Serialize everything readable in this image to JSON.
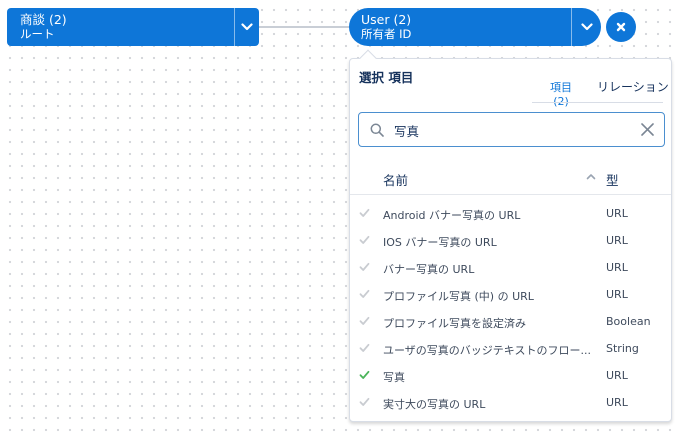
{
  "colors": {
    "accent": "#0e76d8",
    "check_active": "#4bb45a",
    "check_inactive": "#c9ccd1",
    "text": "#16325c"
  },
  "nodes": {
    "left": {
      "title": "商談 (2)",
      "subtitle": "ルート",
      "icon": "chevron-down-icon"
    },
    "right": {
      "title": "User (2)",
      "subtitle": "所有者 ID",
      "icon": "chevron-down-icon"
    },
    "close_icon": "close-icon"
  },
  "panel": {
    "title": "選択 項目",
    "tabs": [
      {
        "label": "項目 (2)",
        "active": true
      },
      {
        "label": "リレーション",
        "active": false
      }
    ],
    "search": {
      "value": "写真",
      "icon": "search-icon",
      "clear_icon": "clear-icon"
    },
    "columns": {
      "name": "名前",
      "type": "型",
      "sort_icon": "sort-up-icon"
    },
    "rows": [
      {
        "name": "Android バナー写真の URL",
        "type": "URL",
        "selected": false
      },
      {
        "name": "IOS バナー写真の URL",
        "type": "URL",
        "selected": false
      },
      {
        "name": "バナー写真の URL",
        "type": "URL",
        "selected": false
      },
      {
        "name": "プロファイル写真 (中) の URL",
        "type": "URL",
        "selected": false
      },
      {
        "name": "プロファイル写真を設定済み",
        "type": "Boolean",
        "selected": false
      },
      {
        "name": "ユーザの写真のバッジテキストのフロー...",
        "type": "String",
        "selected": false
      },
      {
        "name": "写真",
        "type": "URL",
        "selected": true
      },
      {
        "name": "実寸大の写真の URL",
        "type": "URL",
        "selected": false
      }
    ]
  }
}
